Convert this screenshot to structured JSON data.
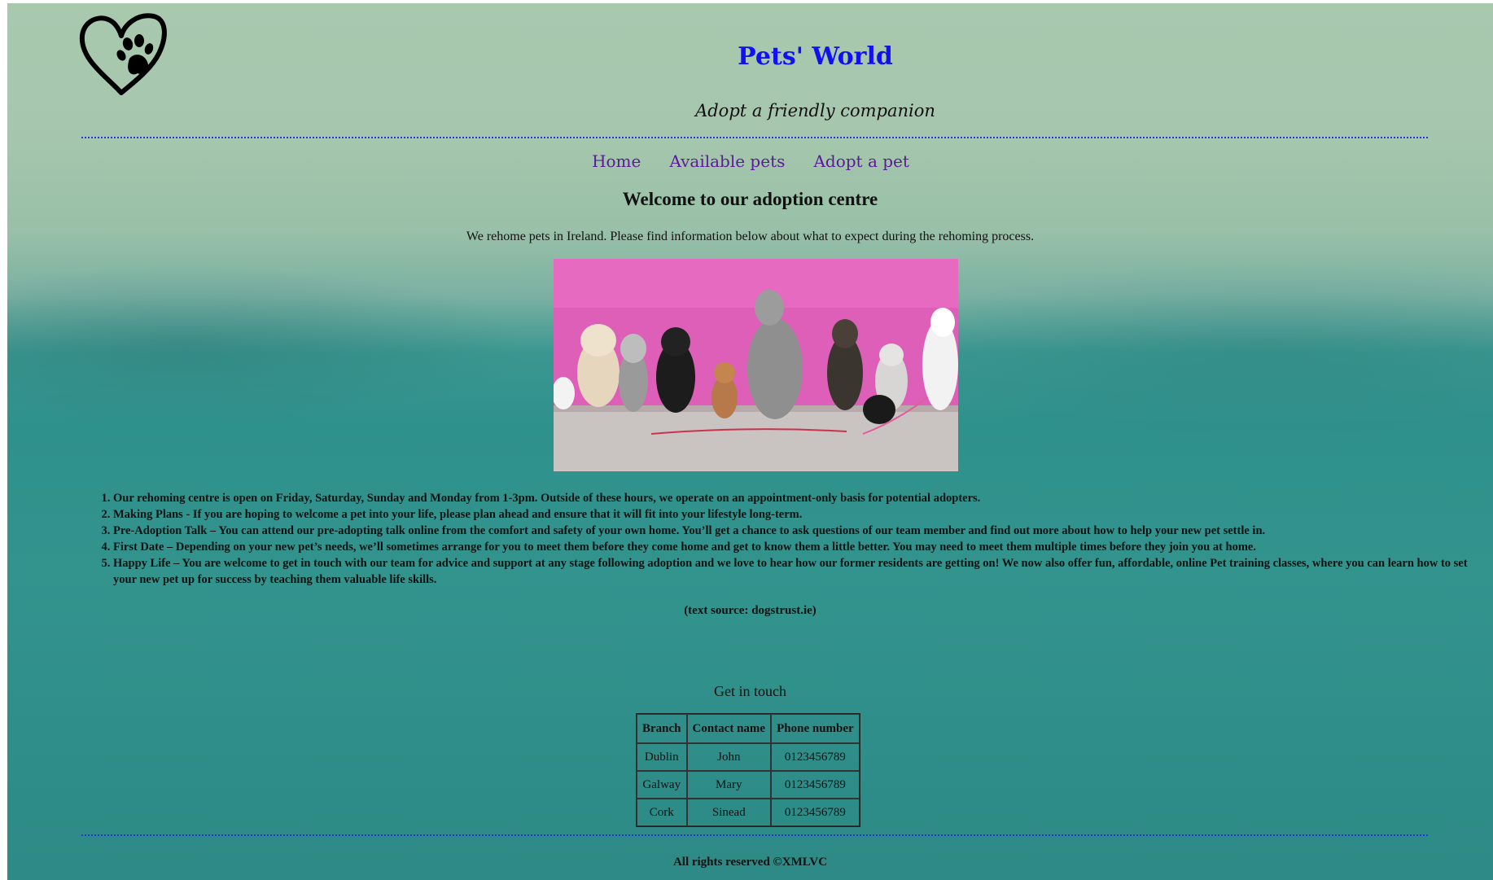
{
  "header": {
    "title": "Pets' World",
    "tagline": "Adopt a friendly companion"
  },
  "nav": {
    "items": [
      {
        "label": "Home"
      },
      {
        "label": "Available pets"
      },
      {
        "label": "Adopt a pet"
      }
    ]
  },
  "main": {
    "heading": "Welcome to our adoption centre",
    "intro": "We rehome pets in Ireland. Please find information below about what to expect during the rehoming process.",
    "steps": [
      "Our rehoming centre is open on Friday, Saturday, Sunday and Monday from 1-3pm. Outside of these hours, we operate on an appointment-only basis for potential adopters.",
      "Making Plans - If you are hoping to welcome a pet into your life, please plan ahead and ensure that it will fit into your lifestyle long-term.",
      "Pre-Adoption Talk – You can attend our pre-adopting talk online from the comfort and safety of your own home. You’ll get a chance to ask questions of our team member and find out more about how to help your new pet settle in.",
      "First Date – Depending on your new pet’s needs, we’ll sometimes arrange for you to meet them before they come home and get to know them a little better. You may need to meet them multiple times before they join you at home.",
      "Happy Life – You are welcome to get in touch with our team for advice and support at any stage following adoption and we love to hear how our former residents are getting on! We now also offer fun, affordable, online Pet training classes, where you can learn how to set your new pet up for success by teaching them valuable life skills."
    ],
    "source": "(text source: dogstrust.ie)"
  },
  "contact": {
    "title": "Get in touch",
    "headers": [
      "Branch",
      "Contact name",
      "Phone number"
    ],
    "rows": [
      [
        "Dublin",
        "John",
        "0123456789"
      ],
      [
        "Galway",
        "Mary",
        "0123456789"
      ],
      [
        "Cork",
        "Sinead",
        "0123456789"
      ]
    ]
  },
  "footer": {
    "text": "All rights reserved ©XMLVC"
  },
  "colors": {
    "title": "#1010f0",
    "nav_link": "#5a1a9a",
    "rule": "#2a33e0",
    "hero_wall": "#de5fb8"
  },
  "icons": {
    "logo": "heart-paw-icon"
  }
}
